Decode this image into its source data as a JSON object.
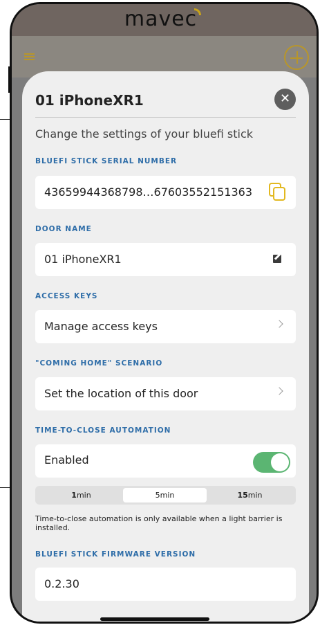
{
  "app": {
    "logo_text": "mavec"
  },
  "sheet": {
    "title": "01 iPhoneXR1",
    "subtitle": "Change the settings of your bluefi stick",
    "sections": {
      "serial": {
        "label": "BLUEFI STICK SERIAL NUMBER",
        "value": "43659944368798…67603552151363"
      },
      "door_name": {
        "label": "DOOR NAME",
        "value": "01 iPhoneXR1"
      },
      "access_keys": {
        "label": "ACCESS KEYS",
        "value": "Manage access keys"
      },
      "coming_home": {
        "label": "\"COMING HOME\" SCENARIO",
        "value": "Set the location of this door"
      },
      "time_to_close": {
        "label": "TIME-TO-CLOSE AUTOMATION",
        "toggle_label": "Enabled",
        "toggle_on": true,
        "options": [
          {
            "num": "1",
            "unit": "min"
          },
          {
            "num": "5",
            "unit": "min"
          },
          {
            "num": "15",
            "unit": "min"
          }
        ],
        "selected_index": 1,
        "note": "Time-to-close automation is only available when a light barrier is installed."
      },
      "firmware": {
        "label": "BLUEFI STICK FIRMWARE VERSION",
        "value": "0.2.30"
      }
    }
  },
  "colors": {
    "accent_gold": "#e2b81f",
    "section_label_blue": "#2e6da8",
    "toggle_green": "#5bb572"
  },
  "icons": [
    "menu-icon",
    "add-icon",
    "close-icon",
    "copy-icon",
    "edit-icon",
    "chevron-right-icon"
  ]
}
